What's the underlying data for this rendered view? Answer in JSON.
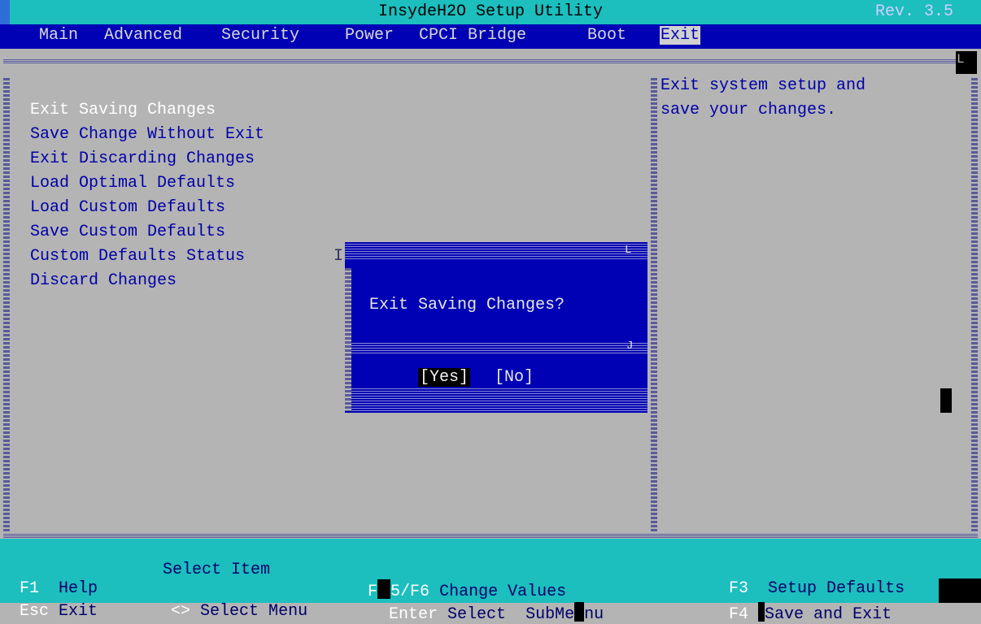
{
  "app_title": "InsydeH2O Setup Utility",
  "revision": "Rev. 3.5",
  "tabs": [
    {
      "label": "Main",
      "active": false
    },
    {
      "label": "Advanced",
      "active": false
    },
    {
      "label": "Security",
      "active": false
    },
    {
      "label": "Power",
      "active": false
    },
    {
      "label": "CPCI Bridge",
      "active": false
    },
    {
      "label": "Boot",
      "active": false
    },
    {
      "label": "Exit",
      "active": true
    }
  ],
  "menu_items": [
    "Exit Saving Changes",
    "Save Change Without Exit",
    "Exit Discarding Changes",
    "Load Optimal Defaults",
    "Load Custom Defaults",
    "Save Custom Defaults",
    "Custom Defaults Status",
    "Discard Changes"
  ],
  "selected_item": "Exit Saving Changes",
  "help_text": [
    "Exit system setup and",
    "save your changes."
  ],
  "dialog": {
    "message": "Exit Saving Changes?",
    "yes_label": "[Yes]",
    "no_label": "[No]",
    "focused": "Yes"
  },
  "footer": {
    "row1": {
      "f1_key": "F1",
      "f1_desc": "Help",
      "select_item": "Select Item",
      "f5_key_prefix": "F",
      "f5_key_suffix": "5/F6",
      "f5_desc": "Change Values",
      "f3_key": "F3",
      "f3_desc": "Setup Defaults"
    },
    "row2": {
      "esc_key": "Esc",
      "esc_desc": "Exit",
      "select_menu_key": "<>",
      "select_menu_desc": "Select Menu",
      "enter_key": "Enter",
      "enter_desc_a": "Select",
      "submenu_a": "SubMe",
      "submenu_b": "nu",
      "f4_key": "F4",
      "f4_desc": "Save and Exit"
    }
  },
  "colors": {
    "cyan_bar": "#1cbebe",
    "menu_blue": "#0000b4",
    "panel_gray": "#b4b4b4",
    "item_text": "#0000a8",
    "highlight_text": "#ffffff"
  }
}
